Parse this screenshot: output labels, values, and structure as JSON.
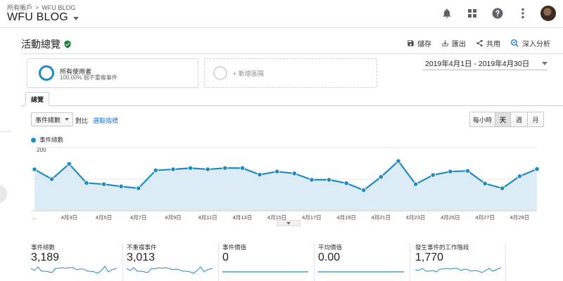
{
  "header": {
    "breadcrumb_root": "所有帳戶",
    "breadcrumb_sep": ">",
    "breadcrumb_property": "WFU BLOG",
    "account_name": "WFU BLOG",
    "icons": [
      "bell-icon",
      "apps-grid-icon",
      "help-icon",
      "more-vert-icon",
      "avatar"
    ]
  },
  "report": {
    "title": "活動總覽",
    "actions": [
      {
        "label": "儲存",
        "icon": "save-icon"
      },
      {
        "label": "匯出",
        "icon": "export-icon"
      },
      {
        "label": "共用",
        "icon": "share-icon"
      },
      {
        "label": "深入分析",
        "icon": "insights-icon"
      }
    ]
  },
  "segments": {
    "primary_name": "所有使用者",
    "primary_sub": "100.00% 個不重複事件",
    "add_label": "+ 新增區隔"
  },
  "date_range": "2019年4月1日 - 2019年4月30日",
  "tabs": [
    "總覽"
  ],
  "controls": {
    "metric_select": "事件總數",
    "versus_label": "對比",
    "pick_metric": "選取指標",
    "granularity": [
      "每小時",
      "天",
      "週",
      "月"
    ],
    "granularity_selected": "天"
  },
  "colors": {
    "series": "#1e8bc3",
    "area_fill": "#dcecf6",
    "link": "#1a73e8",
    "check": "#188038"
  },
  "chart_data": {
    "type": "area",
    "legend": [
      "事件總數"
    ],
    "ylim": [
      0,
      200
    ],
    "yticks": [
      100,
      200
    ],
    "x": [
      "4月1日",
      "4月2日",
      "4月3日",
      "4月4日",
      "4月5日",
      "4月6日",
      "4月7日",
      "4月8日",
      "4月9日",
      "4月10日",
      "4月11日",
      "4月12日",
      "4月13日",
      "4月14日",
      "4月15日",
      "4月16日",
      "4月17日",
      "4月18日",
      "4月19日",
      "4月20日",
      "4月21日",
      "4月22日",
      "4月23日",
      "4月24日",
      "4月25日",
      "4月26日",
      "4月27日",
      "4月28日",
      "4月29日",
      "4月30日"
    ],
    "xtick_labels": [
      "...",
      "4月3日",
      "4月5日",
      "4月7日",
      "4月9日",
      "4月11日",
      "4月13日",
      "4月15日",
      "4月17日",
      "4月19日",
      "4月21日",
      "4月23日",
      "4月25日",
      "4月27日",
      "4月29日"
    ],
    "series": [
      {
        "name": "事件總數",
        "values": [
          131,
          100,
          148,
          88,
          84,
          77,
          71,
          128,
          131,
          135,
          131,
          135,
          135,
          114,
          124,
          118,
          98,
          98,
          87,
          65,
          107,
          157,
          84,
          113,
          124,
          126,
          86,
          71,
          109,
          132
        ]
      }
    ]
  },
  "metrics": [
    {
      "label": "事件總數",
      "value": "3,189"
    },
    {
      "label": "不重複事件",
      "value": "3,013"
    },
    {
      "label": "事件價值",
      "value": "0"
    },
    {
      "label": "平均價值",
      "value": "0.00"
    },
    {
      "label": "發生事件的工作階段",
      "value": "1,770"
    }
  ]
}
